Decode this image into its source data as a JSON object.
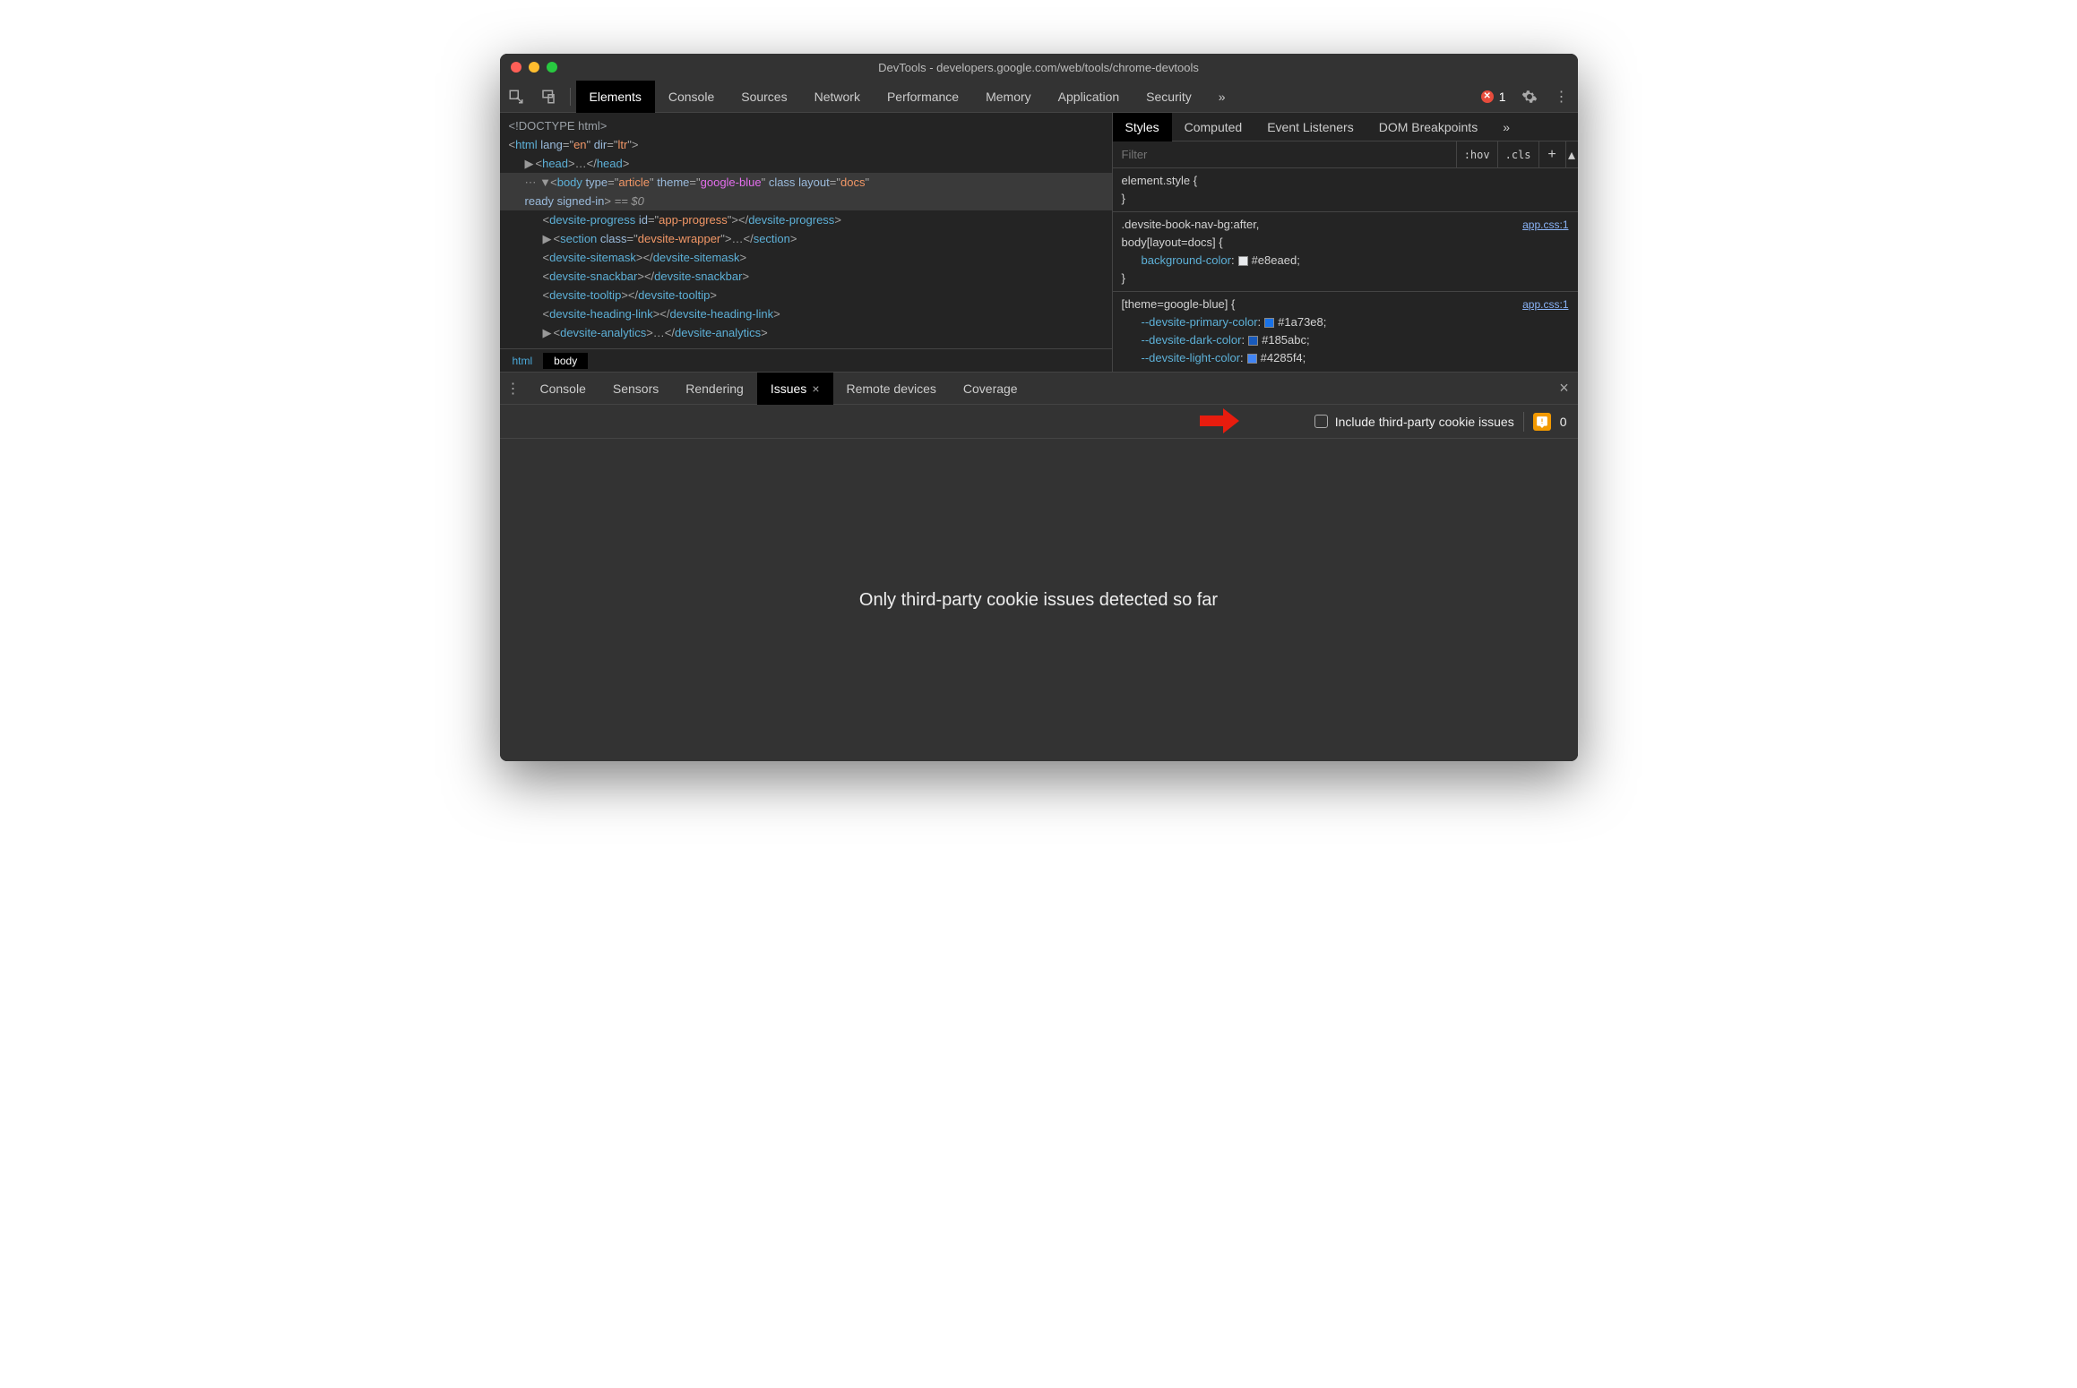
{
  "window": {
    "title": "DevTools - developers.google.com/web/tools/chrome-devtools"
  },
  "main_tabs": {
    "items": [
      "Elements",
      "Console",
      "Sources",
      "Network",
      "Performance",
      "Memory",
      "Application",
      "Security"
    ],
    "active": 0,
    "error_count": "1",
    "error_glyph": "✕"
  },
  "dom": {
    "doctype": "<!DOCTYPE html>",
    "html_open": "<html lang=\"en\" dir=\"ltr\">",
    "head": "<head>…</head>",
    "body_open": "<body type=\"article\" theme=\"google-blue\" class layout=\"docs\" ready signed-in>",
    "body_eq": " == $0",
    "children": [
      "<devsite-progress id=\"app-progress\"></devsite-progress>",
      "<section class=\"devsite-wrapper\">…</section>",
      "<devsite-sitemask></devsite-sitemask>",
      "<devsite-snackbar></devsite-snackbar>",
      "<devsite-tooltip></devsite-tooltip>",
      "<devsite-heading-link></devsite-heading-link>",
      "<devsite-analytics>…</devsite-analytics>"
    ],
    "crumbs": [
      "html",
      "body"
    ]
  },
  "styles": {
    "tabs": [
      "Styles",
      "Computed",
      "Event Listeners",
      "DOM Breakpoints"
    ],
    "active_tab": 0,
    "filter_placeholder": "Filter",
    "hov": ":hov",
    "cls": ".cls",
    "rules": [
      {
        "selector": "element.style {",
        "close": "}",
        "src": ""
      },
      {
        "selector": ".devsite-book-nav-bg:after, body[layout=docs] {",
        "src": "app.css:1",
        "props": [
          {
            "name": "background-color",
            "value": "#e8eaed",
            "swatch": "#e8eaed"
          }
        ],
        "close": "}"
      },
      {
        "selector": "[theme=google-blue] {",
        "src": "app.css:1",
        "props": [
          {
            "name": "--devsite-primary-color",
            "value": "#1a73e8",
            "swatch": "#1a73e8"
          },
          {
            "name": "--devsite-dark-color",
            "value": "#185abc",
            "swatch": "#185abc"
          },
          {
            "name": "--devsite-light-color",
            "value": "#4285f4",
            "swatch": "#4285f4"
          }
        ]
      }
    ]
  },
  "drawer": {
    "tabs": [
      "Console",
      "Sensors",
      "Rendering",
      "Issues",
      "Remote devices",
      "Coverage"
    ],
    "active_tab": 3
  },
  "issues": {
    "checkbox_label": "Include third-party cookie issues",
    "badge_count": "0",
    "body_message": "Only third-party cookie issues detected so far"
  }
}
